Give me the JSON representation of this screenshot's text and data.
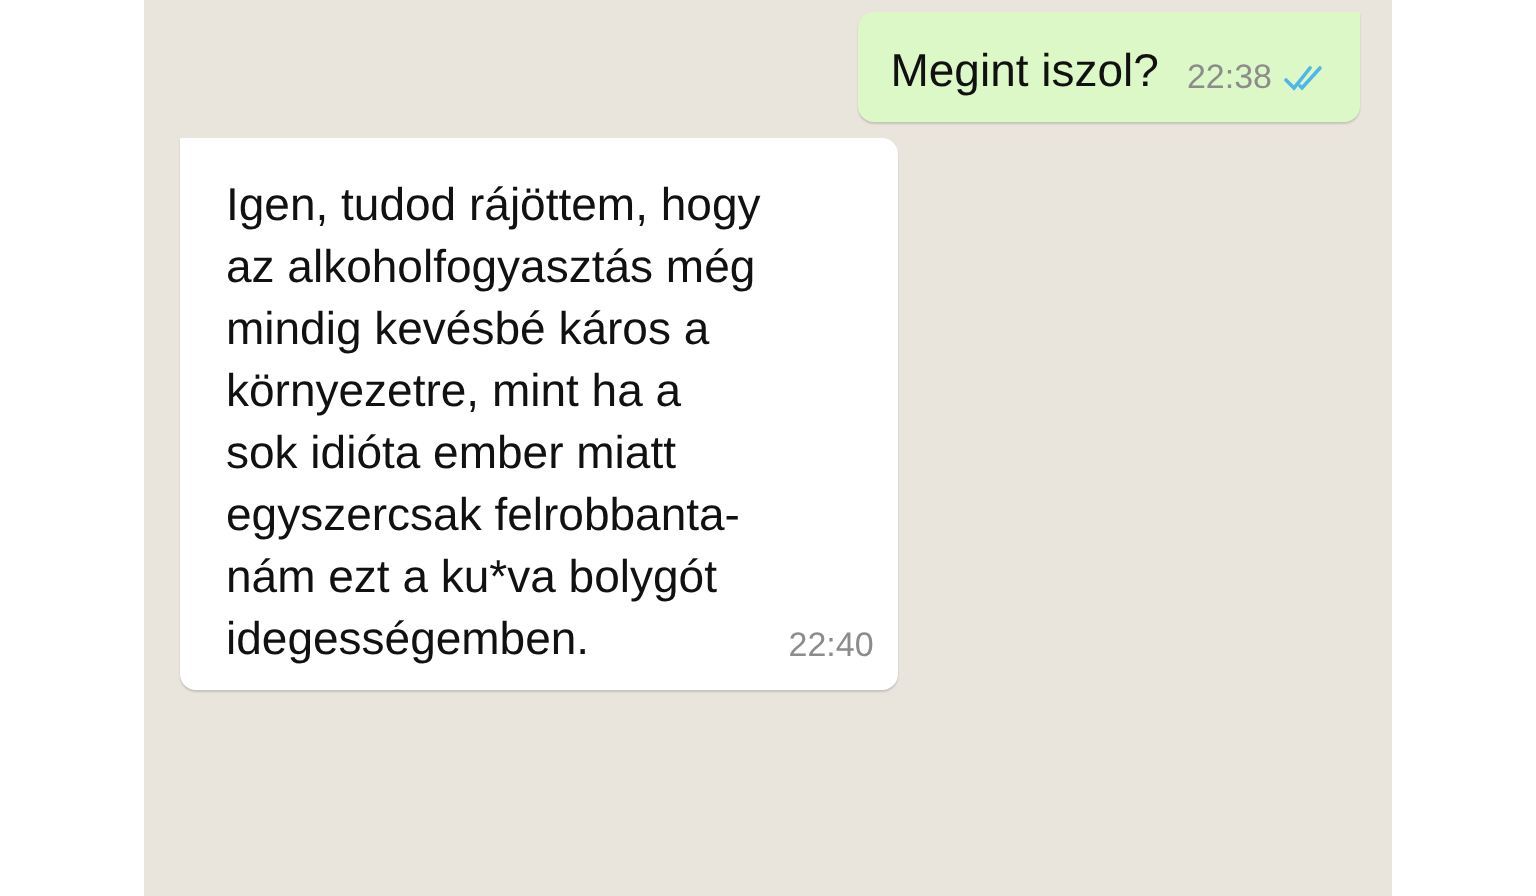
{
  "messages": [
    {
      "kind": "outgoing",
      "text": "Megint iszol?",
      "time": "22:38",
      "read": true
    },
    {
      "kind": "incoming",
      "text": "Igen, tudod rájöttem, hogy\naz alkoholfogyasztás még\nmindig kevésbé káros a\nkörnyezetre, mint ha a\nsok idióta ember miatt\negyszercsak felrobbanta-\nnám ezt a ku*va bolygót\nidegességemben.",
      "time": "22:40"
    }
  ]
}
